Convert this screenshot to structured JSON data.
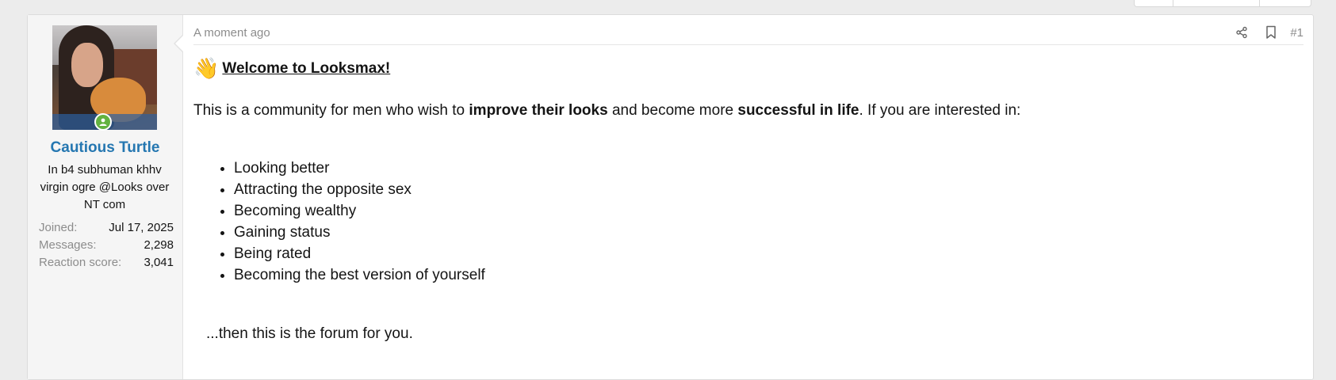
{
  "post": {
    "timestamp": "A moment ago",
    "post_number": "#1",
    "title": "Welcome to Looksmax!",
    "wave_emoji": "👋",
    "intro": {
      "part1": "This is a community for men who wish to ",
      "bold1": "improve their looks",
      "part2": " and become more ",
      "bold2": "successful in life",
      "part3": ". If you are interested in:"
    },
    "list_items": [
      "Looking better",
      "Attracting the opposite sex",
      "Becoming wealthy",
      "Gaining status",
      "Being rated",
      "Becoming the best version of yourself"
    ],
    "closing": "...then this is the forum for you."
  },
  "user": {
    "name": "Cautious Turtle",
    "title": "In b4 subhuman khhv virgin ogre @Looks over NT com",
    "stats": [
      {
        "label": "Joined:",
        "value": "Jul 17, 2025"
      },
      {
        "label": "Messages:",
        "value": "2,298"
      },
      {
        "label": "Reaction score:",
        "value": "3,041"
      }
    ],
    "status": "online"
  },
  "icons": {
    "share": "share-icon",
    "bookmark": "bookmark-icon",
    "online": "user-online-icon"
  },
  "colors": {
    "username": "#2577b1",
    "online": "#63b241",
    "muted": "#8c8c8c"
  }
}
